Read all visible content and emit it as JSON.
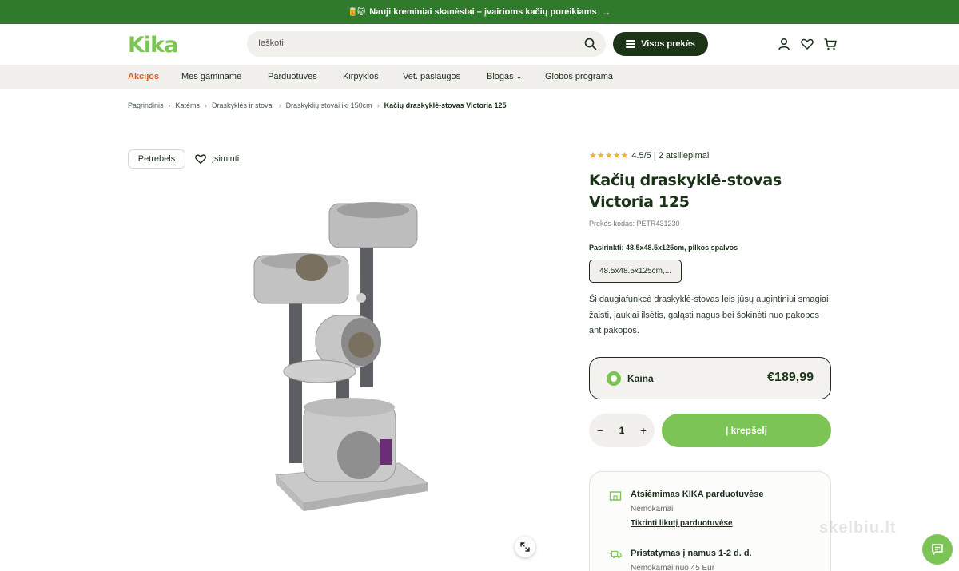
{
  "promo": {
    "emoji": "🥫🐱",
    "text": "Nauji kreminiai skanėstai – įvairioms kačių poreikiams",
    "arrow": "→"
  },
  "header": {
    "logo": "Kika",
    "search_placeholder": "Ieškoti",
    "all_products": "Visos prekės"
  },
  "nav": {
    "items": [
      "Akcijos",
      "Mes gaminame",
      "Parduotuvės",
      "Kirpyklos",
      "Vet. paslaugos",
      "Blogas",
      "Globos programa"
    ],
    "blog_caret": "⌄"
  },
  "breadcrumb": {
    "items": [
      "Pagrindinis",
      "Katėms",
      "Draskyklės ir stovai",
      "Draskyklių stovai iki 150cm"
    ],
    "current": "Kačių draskyklė-stovas Victoria 125",
    "separator": "›"
  },
  "product": {
    "brand": "Petrebels",
    "wishlist": "Įsiminti",
    "stars": "★★★★★",
    "rating": 4.5,
    "rating_text": "4.5/5 | 2 atsiliepimai",
    "title": "Kačių draskyklė-stovas Victoria 125",
    "sku": "Prekės kodas: PETR431230",
    "choose_label": "Pasirinkti: 48.5x48.5x125cm, pilkos spalvos",
    "variant": "48.5x48.5x125cm,...",
    "description": "Ši daugiafunkcė draskyklė-stovas leis jūsų augintiniui smagiai žaisti, jaukiai ilsėtis, galąsti nagus bei šokinėti nuo pakopos ant pakopos.",
    "price_label": "Kaina",
    "price": "€189,99",
    "qty_minus": "−",
    "qty": "1",
    "qty_plus": "+",
    "add_to_cart": "Į krepšelį"
  },
  "delivery": {
    "pickup_title": "Atsiėmimas KIKA parduotuvėse",
    "pickup_sub": "Nemokamai",
    "pickup_link": "Tikrinti likutį parduotuvėse",
    "home_title": "Pristatymas į namus 1-2 d. d.",
    "home_sub": "Nemokamai nuo 45 Eur"
  },
  "watermark": "skelbiu.lt",
  "colors": {
    "brand_green": "#7cc456",
    "promo_green": "#2f7a2b",
    "dark_green": "#1d3516",
    "sale_orange": "#e05a2b",
    "star_gold": "#f0b323"
  }
}
